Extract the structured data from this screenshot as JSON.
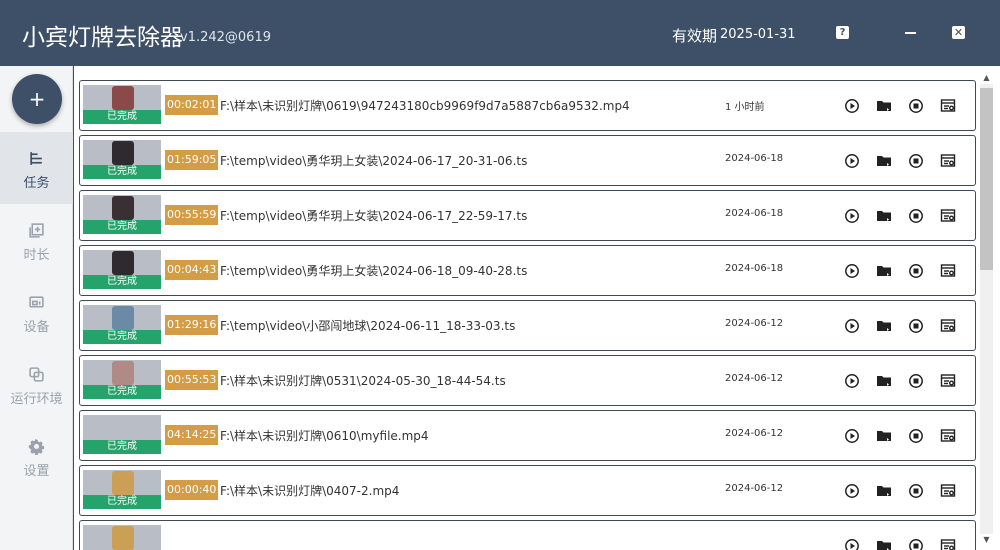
{
  "app": {
    "title": "小宾灯牌去除器",
    "version": "v1.242@0619",
    "validity_label": "有效期",
    "validity_date": "2025-01-31",
    "help_label": "?",
    "close_label": "✕"
  },
  "sidebar": {
    "add_label": "+",
    "items": [
      {
        "label": "任务",
        "icon": "task-list-icon"
      },
      {
        "label": "时长",
        "icon": "duration-add-icon"
      },
      {
        "label": "设备",
        "icon": "device-icon"
      },
      {
        "label": "运行环境",
        "icon": "environment-icon"
      },
      {
        "label": "设置",
        "icon": "gear-icon"
      }
    ]
  },
  "colors": {
    "header": "#3d5068",
    "status_done": "#24a36b",
    "duration_badge": "#d49c45"
  },
  "tasks": [
    {
      "status": "已完成",
      "duration": "00:02:01",
      "path": "F:\\样本\\未识别灯牌\\0619\\947243180cb9969f9d7a5887cb6a9532.mp4",
      "time": "1 小时前"
    },
    {
      "status": "已完成",
      "duration": "01:59:05",
      "path": "F:\\temp\\video\\勇华玥上女装\\2024-06-17_20-31-06.ts",
      "time": "2024-06-18"
    },
    {
      "status": "已完成",
      "duration": "00:55:59",
      "path": "F:\\temp\\video\\勇华玥上女装\\2024-06-17_22-59-17.ts",
      "time": "2024-06-18"
    },
    {
      "status": "已完成",
      "duration": "00:04:43",
      "path": "F:\\temp\\video\\勇华玥上女装\\2024-06-18_09-40-28.ts",
      "time": "2024-06-18"
    },
    {
      "status": "已完成",
      "duration": "01:29:16",
      "path": "F:\\temp\\video\\小邵闯地球\\2024-06-11_18-33-03.ts",
      "time": "2024-06-12"
    },
    {
      "status": "已完成",
      "duration": "00:55:53",
      "path": "F:\\样本\\未识别灯牌\\0531\\2024-05-30_18-44-54.ts",
      "time": "2024-06-12"
    },
    {
      "status": "已完成",
      "duration": "04:14:25",
      "path": "F:\\样本\\未识别灯牌\\0610\\myfile.mp4",
      "time": "2024-06-12"
    },
    {
      "status": "已完成",
      "duration": "00:00:40",
      "path": "F:\\样本\\未识别灯牌\\0407-2.mp4",
      "time": "2024-06-12"
    },
    {
      "status": "",
      "duration": "",
      "path": "",
      "time": ""
    }
  ]
}
